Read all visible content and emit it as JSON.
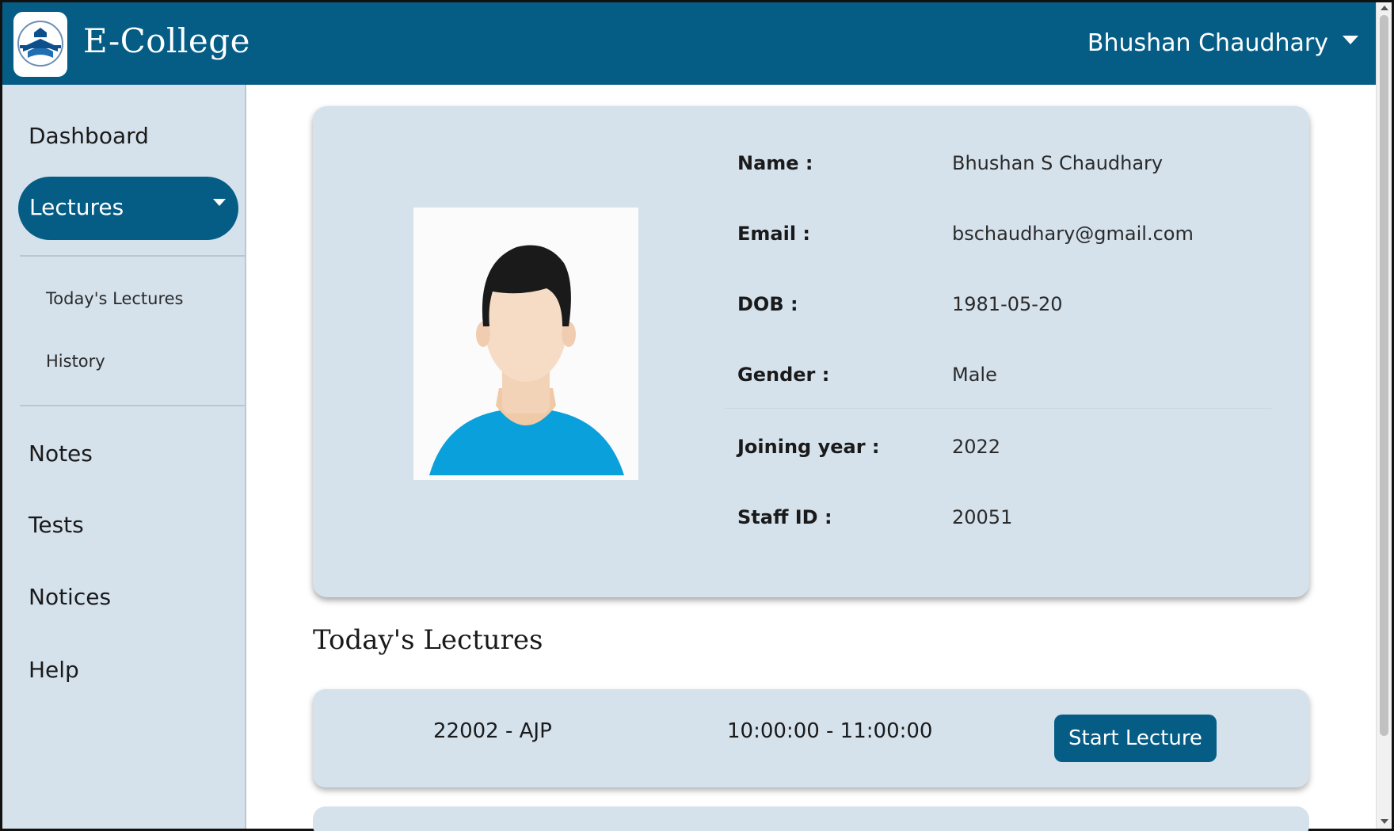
{
  "header": {
    "brand": "E-College",
    "user_name": "Bhushan Chaudhary"
  },
  "sidebar": {
    "dashboard": "Dashboard",
    "lectures": "Lectures",
    "sub_items": [
      "Today's Lectures",
      "History"
    ],
    "notes": "Notes",
    "tests": "Tests",
    "notices": "Notices",
    "help": "Help"
  },
  "profile": {
    "rows": [
      {
        "label": "Name :",
        "value": "Bhushan S Chaudhary"
      },
      {
        "label": "Email :",
        "value": "bschaudhary@gmail.com"
      },
      {
        "label": "DOB :",
        "value": "1981-05-20"
      },
      {
        "label": "Gender :",
        "value": "Male"
      },
      {
        "label": "Joining year :",
        "value": "2022"
      },
      {
        "label": "Staff ID :",
        "value": "20051"
      }
    ]
  },
  "todays_lectures": {
    "title": "Today's Lectures",
    "items": [
      {
        "code": "22002 - AJP",
        "time": "10:00:00 - 11:00:00",
        "button": "Start Lecture"
      }
    ]
  },
  "colors": {
    "primary": "#055d86",
    "panel": "#d5e2ec",
    "avatar_shirt": "#0aa0dc"
  },
  "icons": {
    "logo": "college-logo-icon",
    "user_menu": "chevron-down-icon",
    "lectures_menu": "chevron-down-icon",
    "avatar": "user-avatar-icon"
  }
}
